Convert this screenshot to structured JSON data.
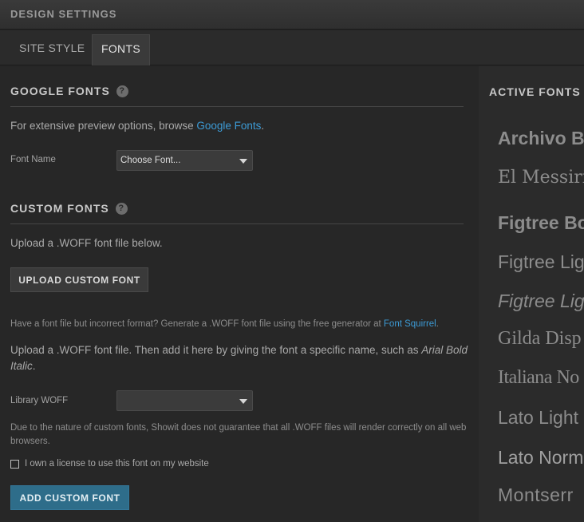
{
  "window": {
    "title": "DESIGN SETTINGS"
  },
  "tabs": [
    {
      "label": "SITE STYLE",
      "active": false
    },
    {
      "label": "FONTS",
      "active": true
    }
  ],
  "google_fonts": {
    "heading": "GOOGLE FONTS",
    "help_icon": "help-icon",
    "intro_prefix": "For extensive preview options, browse ",
    "intro_link": "Google Fonts",
    "intro_suffix": ".",
    "font_name_label": "Font Name",
    "font_select_value": "Choose Font..."
  },
  "custom_fonts": {
    "heading": "CUSTOM FONTS",
    "help_icon": "help-icon",
    "upload_intro": "Upload a .WOFF font file below.",
    "upload_button": "UPLOAD CUSTOM FONT",
    "convert_prefix": "Have a font file but incorrect format? Generate a .WOFF font file using the free generator at ",
    "convert_link": "Font Squirrel",
    "convert_suffix": ".",
    "instructions_prefix": "Upload a .WOFF font file. Then add it here by giving the font a specific name, such as ",
    "instructions_example": "Arial Bold Italic",
    "instructions_suffix": ".",
    "library_label": "Library WOFF",
    "library_value": "",
    "disclaimer": "Due to the nature of custom fonts, Showit does not guarantee that all .WOFF files will render correctly on all web browsers.",
    "license_checkbox_label": "I own a license to use this font on my website",
    "license_checked": false,
    "add_button": "ADD CUSTOM FONT"
  },
  "active_fonts": {
    "heading": "ACTIVE FONTS",
    "items": [
      "Archivo B",
      "El Messiri ",
      "Figtree Bo",
      "Figtree Lig",
      "Figtree Lig",
      "Gilda Disp",
      "Italiana No",
      "Lato Light",
      "Lato Norm",
      "Montserr"
    ]
  },
  "colors": {
    "link": "#3c9bd6",
    "primary_button": "#2e6d8a"
  }
}
